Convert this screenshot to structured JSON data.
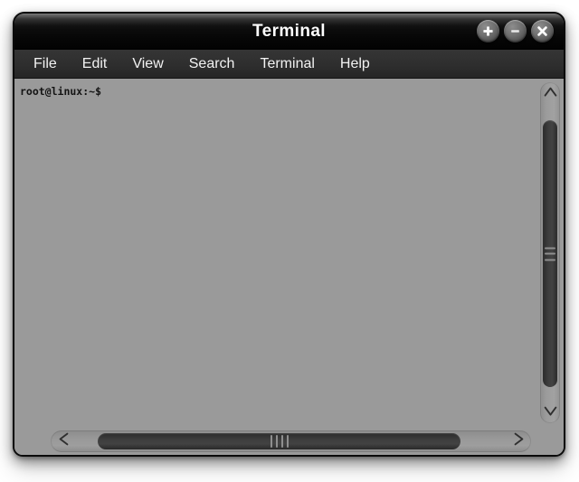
{
  "window": {
    "title": "Terminal",
    "controls": [
      {
        "name": "maximize-button",
        "icon": "plus-icon",
        "glyph": "+"
      },
      {
        "name": "minimize-button",
        "icon": "minus-icon",
        "glyph": "−"
      },
      {
        "name": "close-button",
        "icon": "close-icon",
        "glyph": "×"
      }
    ]
  },
  "menubar": {
    "items": [
      {
        "label": "File"
      },
      {
        "label": "Edit"
      },
      {
        "label": "View"
      },
      {
        "label": "Search"
      },
      {
        "label": "Terminal"
      },
      {
        "label": "Help"
      }
    ]
  },
  "terminal": {
    "lines": [
      "root@linux:~$"
    ],
    "prompt": "root@linux:~$",
    "user": "root",
    "host": "linux",
    "cwd": "~",
    "prompt_symbol": "$",
    "background_color": "#9a9a9a",
    "text_color": "#141414"
  },
  "scrollbars": {
    "vertical": {
      "up_arrow_glyph": "∧",
      "down_arrow_glyph": "∨",
      "grip_lines": 3
    },
    "horizontal": {
      "left_arrow_glyph": "<",
      "right_arrow_glyph": ">",
      "grip_lines": 4
    }
  },
  "colors": {
    "titlebar": "#0a0a0a",
    "menubar": "#2e2e2e",
    "terminal_bg": "#9a9a9a",
    "scrollbar_thumb": "#3d3d3d",
    "text_light": "#f2f2f2"
  }
}
